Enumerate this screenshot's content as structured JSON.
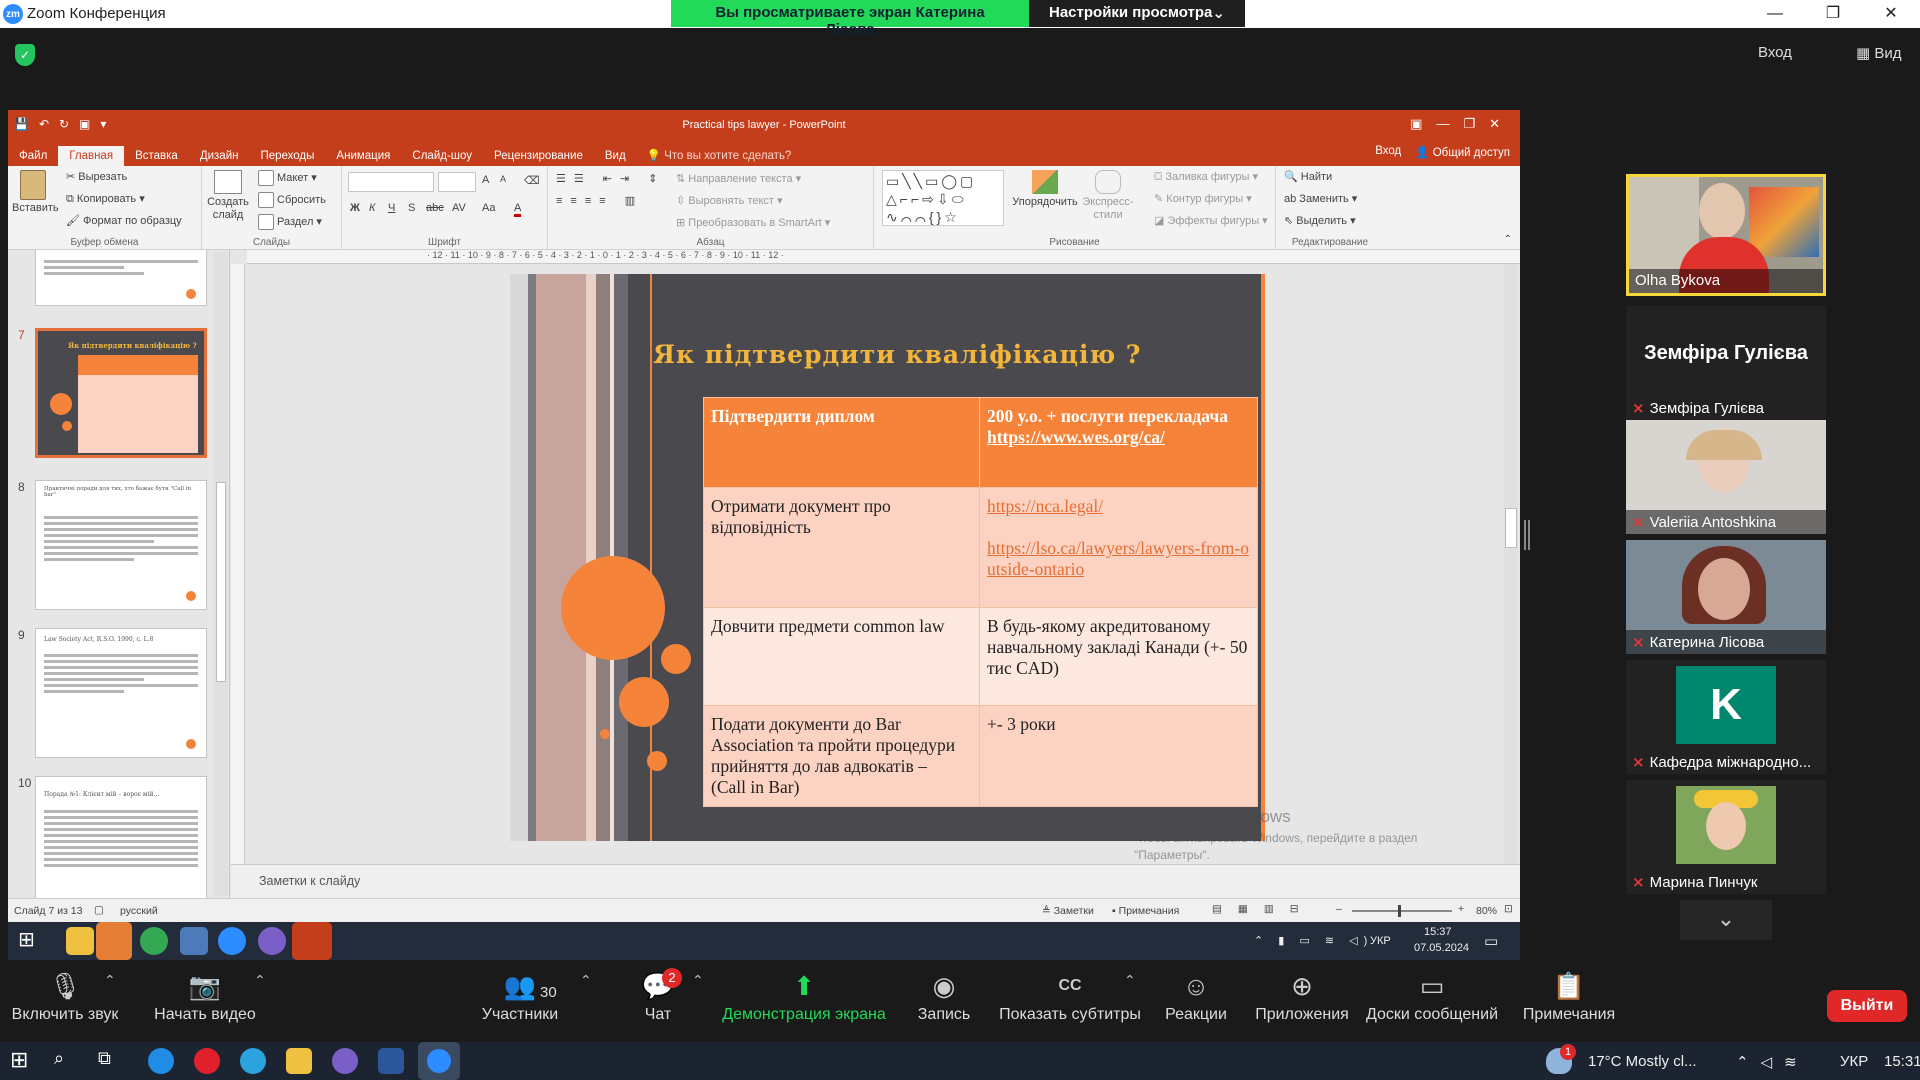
{
  "zoom": {
    "title": "Zoom Конференция",
    "logo": "zm",
    "viewing_banner": "Вы просматриваете экран Катерина Лісова",
    "view_settings": "Настройки просмотра",
    "view_settings_arrow": "⌄",
    "signin": "Вход",
    "view": "Вид",
    "colors": {
      "green": "#23d959",
      "leave": "#e02828",
      "accent": "#2d8cff"
    }
  },
  "ppt": {
    "window_title": "Practical tips lawyer - PowerPoint",
    "tabs": [
      "Файл",
      "Главная",
      "Вставка",
      "Дизайн",
      "Переходы",
      "Анимация",
      "Слайд-шоу",
      "Рецензирование",
      "Вид"
    ],
    "active_tab": "Главная",
    "tell_me": "Что вы хотите сделать?",
    "signin": "Вход",
    "share": "Общий доступ",
    "ribbon": {
      "clipboard": {
        "paste": "Вставить",
        "cut": "Вырезать",
        "copy": "Копировать",
        "format": "Формат по образцу",
        "label": "Буфер обмена"
      },
      "slides": {
        "new_slide": "Создать слайд",
        "layout": "Макет",
        "reset": "Сбросить",
        "section": "Раздел",
        "label": "Слайды"
      },
      "font": {
        "bold": "Ж",
        "italic": "К",
        "underline": "Ч",
        "shadow": "S",
        "strike": "abc",
        "spacing": "AV",
        "case": "Aa",
        "color": "A",
        "grow": "A",
        "shrink": "A",
        "label": "Шрифт"
      },
      "paragraph": {
        "direction": "Направление текста",
        "align": "Выровнять текст",
        "smartart": "Преобразовать в SmartArt",
        "label": "Абзац"
      },
      "drawing": {
        "arrange": "Упорядочить",
        "quick_styles": "Экспресс-стили",
        "fill": "Заливка фигуры",
        "outline": "Контур фигуры",
        "effects": "Эффекты фигуры",
        "label": "Рисование"
      },
      "editing": {
        "find": "Найти",
        "replace": "Заменить",
        "select": "Выделить",
        "label": "Редактирование"
      }
    },
    "thumb_numbers": [
      "7",
      "8",
      "9",
      "10"
    ],
    "thumb_titles": [
      "Як підтвердити кваліфікацію ?",
      "Практичні поради для тих, хто бажає бути \"Call in bar\"",
      "Law Society Act, R.S.O. 1990, c. L.8",
      "Порада №1: Клієнт мій – вороє мій..."
    ],
    "ruler": "· 12 · 11 · 10 · 9 · 8 · 7 · 6 · 5 · 4 · 3 · 2 · 1 · 0 · 1 · 2 · 3 · 4 · 5 · 6 · 7 · 8 · 9 · 10 · 11 · 12 ·",
    "notes_placeholder": "Заметки к слайду",
    "watermark_title": "Активация Windows",
    "watermark_sub": "Чтобы активировать Windows, перейдите в раздел \"Параметры\".",
    "status": {
      "slide": "Слайд 7 из 13",
      "lang": "русский",
      "notes": "Заметки",
      "comments": "Примечания",
      "zoom": "80%"
    }
  },
  "slide": {
    "title": "Як підтвердити кваліфікацію ?",
    "rows": [
      {
        "left": "Підтвердити диплом",
        "right": "200 у.о. + послуги перекладача",
        "link": "https://www.wes.org/ca/"
      },
      {
        "left": "Отримати документ про відповідність",
        "link": "https://nca.legal/",
        "link2": "https://lso.ca/lawyers/lawyers-from-outside-ontario"
      },
      {
        "left": "Довчити предмети common law",
        "right": "В будь-якому акредитованому навчальному закладі Канади  (+- 50 тис CAD)"
      },
      {
        "left": "Подати документи до Bar Association та пройти процедури прийняття до лав адвокатів –\n(Call in Bar)",
        "right": "+- 3 роки"
      }
    ],
    "colors": {
      "bg": "#4a4a4e",
      "accent": "#f5843a",
      "title": "#f3b53c",
      "row_a": "#fcd2c2",
      "row_b": "#fde8e0"
    }
  },
  "inner_taskbar": {
    "time": "15:37",
    "date": "07.05.2024",
    "lang": "УКР"
  },
  "participants": [
    {
      "name": "Olha Bykova",
      "active": true
    },
    {
      "name": "Земфіра Гулієва",
      "big_name": "Земфіра Гулієва"
    },
    {
      "name": "Valeriia Antoshkina"
    },
    {
      "name": "Катерина Лісова"
    },
    {
      "name": "Кафедра міжнародно...",
      "avatar_letter": "K"
    },
    {
      "name": "Марина Пинчук"
    }
  ],
  "participants_more": "⌄",
  "toolbar": {
    "mute": "Включить звук",
    "video": "Начать видео",
    "participants": "Участники",
    "participants_count": "30",
    "chat": "Чат",
    "chat_badge": "2",
    "share": "Демонстрация экрана",
    "record": "Запись",
    "captions": "Показать субтитры",
    "captions_icon": "CC",
    "reactions": "Реакции",
    "apps": "Приложения",
    "whiteboards": "Доски сообщений",
    "notes": "Примечания",
    "leave": "Выйти"
  },
  "os_taskbar": {
    "weather_badge": "1",
    "weather": "17°C  Mostly cl...",
    "lang": "УКР",
    "time": "15:31"
  }
}
